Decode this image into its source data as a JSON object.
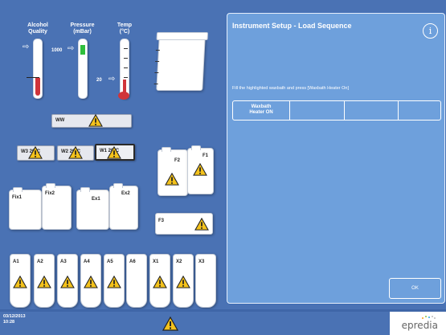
{
  "gauges": {
    "alcohol_label": "Alcohol\nQuality",
    "pressure_label": "Pressure\n(mBar)",
    "temp_label": "Temp\n(°C)",
    "pressure_value": "1000",
    "temp_value": "20"
  },
  "panel": {
    "title": "Instrument Setup - Load Sequence",
    "instruction": "Fill the highlighted waxbath and press [Waxbath Heater On]",
    "sequence": [
      "Waxbath\nHeater ON",
      "",
      "",
      ""
    ],
    "ok_label": "OK"
  },
  "baths": {
    "ww": "WW",
    "w3": "W3",
    "w3_temp": "20°C",
    "w2": "W2",
    "w2_temp": "20°C",
    "w1": "W1",
    "w1_temp": "20°C"
  },
  "bottles": {
    "fix1": "Fix1",
    "fix2": "Fix2",
    "ex1": "Ex1",
    "ex2": "Ex2",
    "f1": "F1",
    "f2": "F2",
    "f3": "F3",
    "row": [
      "A1",
      "A2",
      "A3",
      "A4",
      "A5",
      "A6",
      "X1",
      "X2",
      "X3"
    ]
  },
  "footer": {
    "date": "03/12/2013",
    "time": "10:28",
    "logo": "epredia"
  },
  "colors": {
    "background": "#4a72b4",
    "panel": "#6ea0dc",
    "alcohol_fill": "#d0343a",
    "pressure_fill": "#2fbf3c",
    "warning": "#f4c21b"
  }
}
